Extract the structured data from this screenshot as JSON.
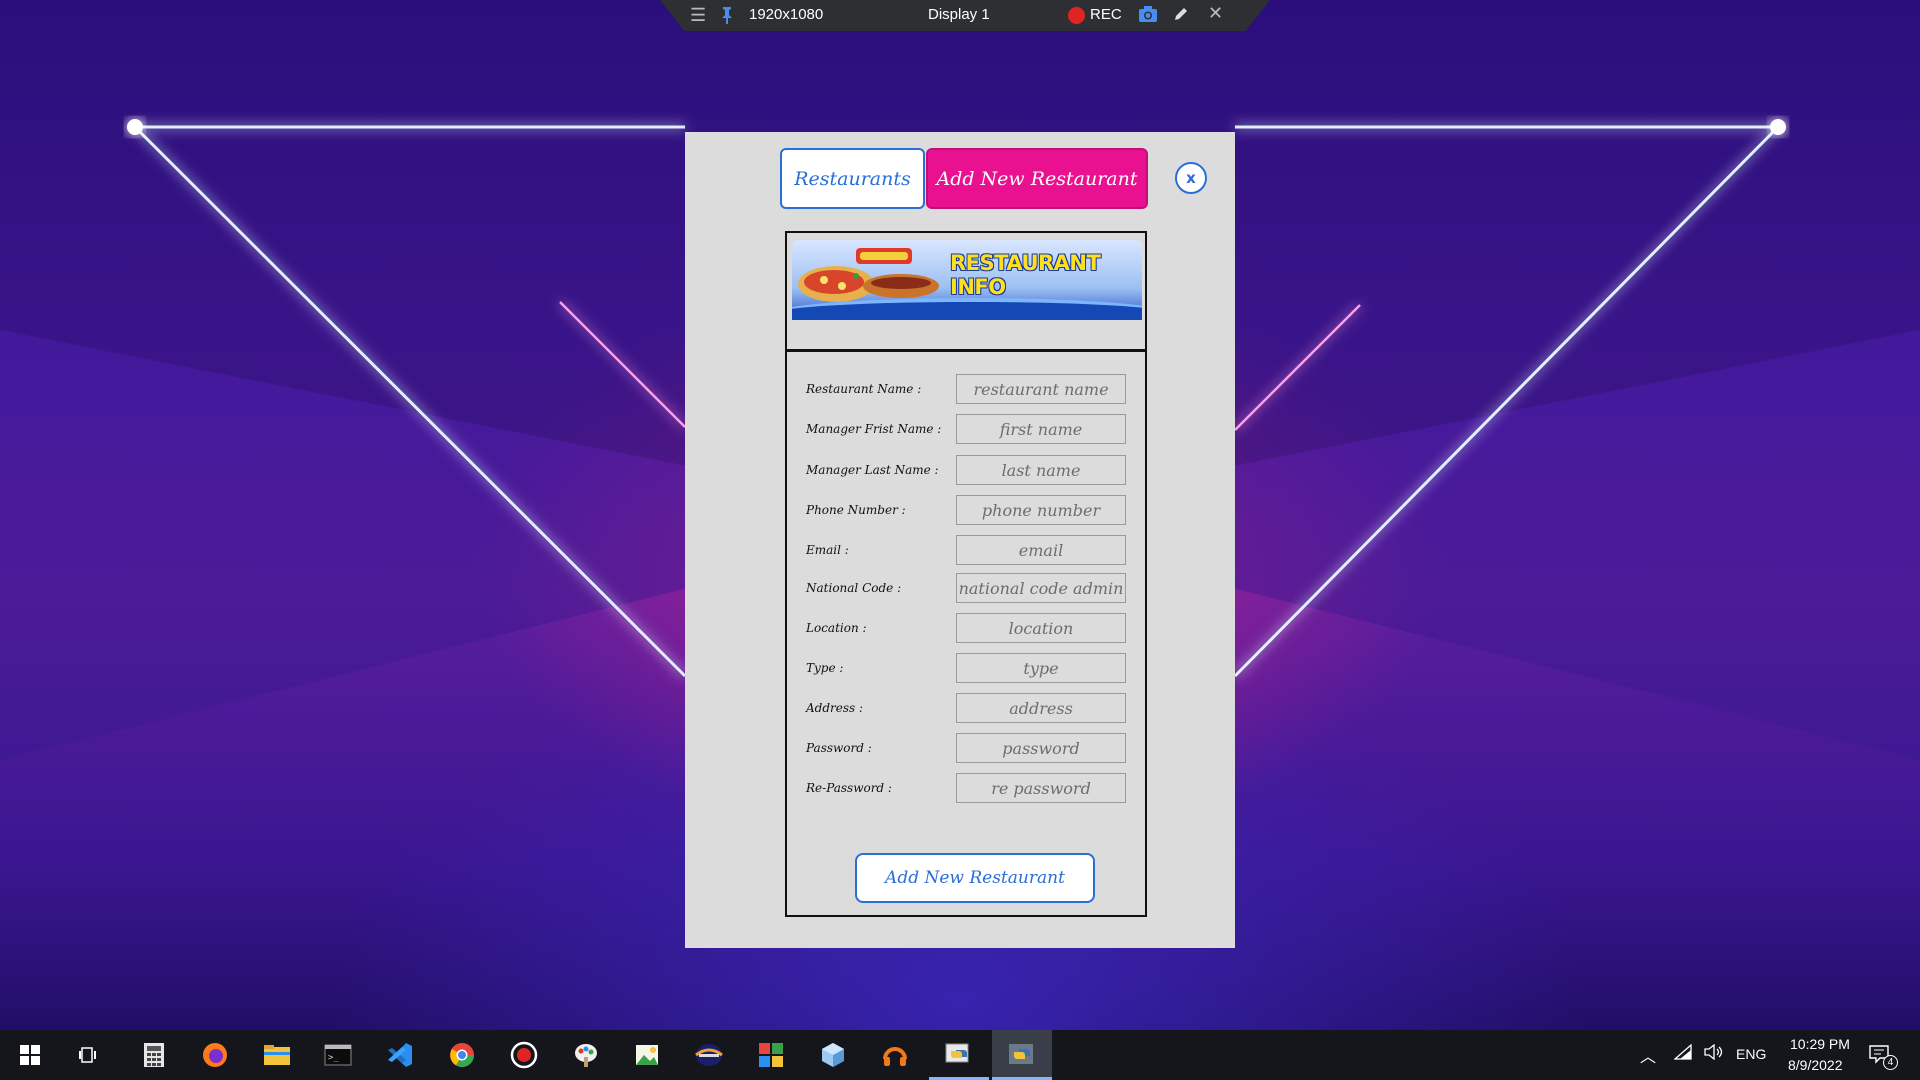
{
  "recorder": {
    "resolution": "1920x1080",
    "display": "Display 1",
    "rec_label": "REC",
    "menu_icon": "hamburger-icon",
    "pin_icon": "pin-icon",
    "camera_icon": "camera-icon",
    "pen_icon": "pen-icon",
    "close_icon": "close-icon"
  },
  "app": {
    "tab_restaurants": "Restaurants",
    "tab_add_new": "Add New Restaurant",
    "close_label": "x",
    "banner_title": "RESTAURANT INFO",
    "submit_label": "Add New Restaurant",
    "colors": {
      "accent_blue": "#2a6fd6",
      "active_tab": "#ea1190",
      "panel_bg": "#dcdcdc"
    },
    "form": {
      "restaurant_name": {
        "label": "Restaurant Name :",
        "placeholder": "restaurant name"
      },
      "manager_first_name": {
        "label": "Manager Frist Name :",
        "placeholder": "first name"
      },
      "manager_last_name": {
        "label": "Manager Last Name :",
        "placeholder": "last name"
      },
      "phone_number": {
        "label": "Phone Number :",
        "placeholder": "phone number"
      },
      "email": {
        "label": "Email :",
        "placeholder": "email"
      },
      "national_code": {
        "label": "National Code :",
        "placeholder": "national code admin"
      },
      "location": {
        "label": "Location :",
        "placeholder": "location"
      },
      "type": {
        "label": "Type :",
        "placeholder": "type"
      },
      "address": {
        "label": "Address :",
        "placeholder": "address"
      },
      "password": {
        "label": "Password :",
        "placeholder": "password"
      },
      "re_password": {
        "label": "Re-Password :",
        "placeholder": "re password"
      }
    }
  },
  "taskbar": {
    "icons": [
      "windows-start-icon",
      "task-view-icon",
      "calculator-icon",
      "firefox-icon",
      "file-explorer-icon",
      "terminal-icon",
      "vscode-icon",
      "chrome-icon",
      "obs-record-icon",
      "paint-icon",
      "image-editor-icon",
      "app-icon",
      "windows-tiles-icon",
      "box-icon",
      "headphones-icon",
      "python-idle-icon",
      "python-app-icon"
    ],
    "language": "ENG",
    "time": "10:29 PM",
    "date": "8/9/2022",
    "notification_count": "4"
  }
}
